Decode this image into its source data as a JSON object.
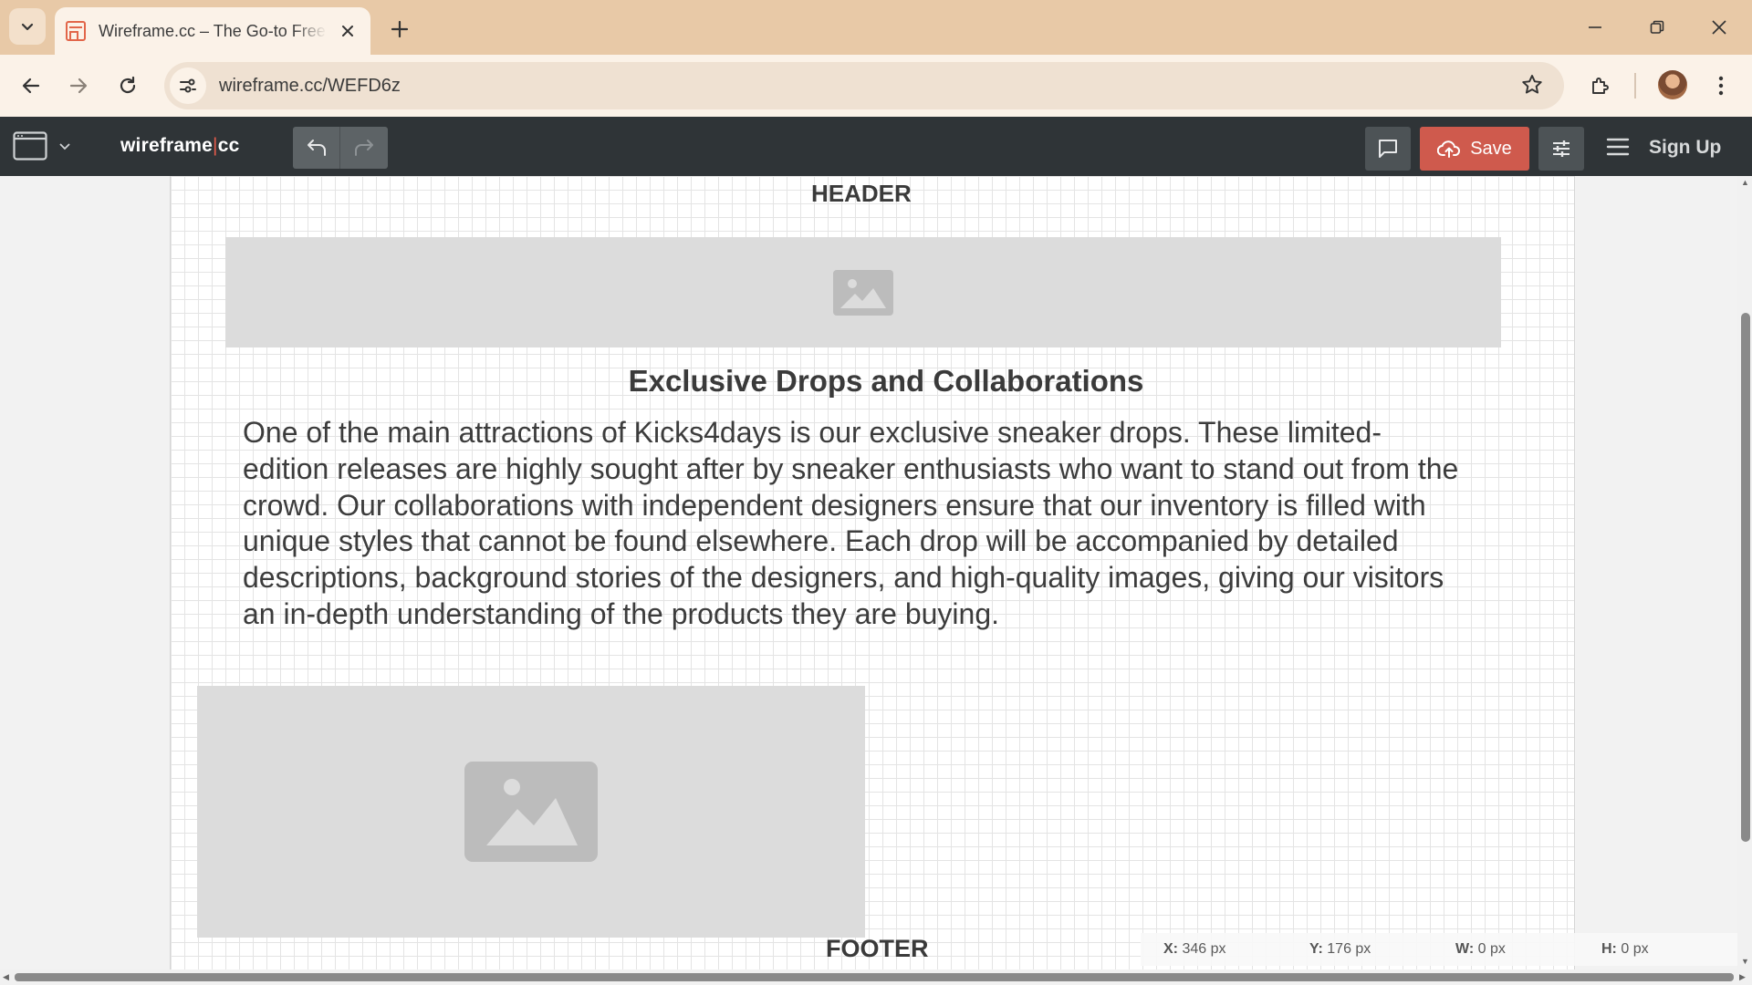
{
  "browser": {
    "tab_title": "Wireframe.cc – The Go-to Free, Minimal Wireframing Tool",
    "url": "wireframe.cc/WEFD6z"
  },
  "app": {
    "logo_main": "wireframe",
    "logo_bar": "|",
    "logo_suffix": "cc",
    "save_label": "Save",
    "signup_label": "Sign Up"
  },
  "canvas": {
    "header_label": "HEADER",
    "heading": "Exclusive Drops and Collaborations",
    "paragraph": "One of the main attractions of Kicks4days is our exclusive sneaker drops. These limited-edition releases are highly sought after by sneaker enthusiasts who want to stand out from the crowd. Our collaborations with independent designers ensure that our inventory is filled with unique styles that cannot be found elsewhere. Each drop will be accompanied by detailed descriptions, background stories of the designers, and high-quality images, giving our visitors an in-depth understanding of the products they are buying.",
    "footer_label": "FOOTER"
  },
  "status": {
    "x_label": "X:",
    "x_value": "346 px",
    "y_label": "Y:",
    "y_value": "176 px",
    "w_label": "W:",
    "w_value": "0 px",
    "h_label": "H:",
    "h_value": "0 px"
  },
  "colors": {
    "header_bg": "#2f3437",
    "save_bg": "#cf5a4d",
    "accent": "#e05a4b",
    "placeholder": "#dcdcdc"
  },
  "icons": [
    "tab-search-icon",
    "favicon-icon",
    "close-icon",
    "plus-icon",
    "minimize-icon",
    "restore-icon",
    "window-close-icon",
    "back-icon",
    "forward-icon",
    "reload-icon",
    "site-info-icon",
    "star-icon",
    "extensions-icon",
    "more-icon",
    "pages-icon",
    "undo-icon",
    "redo-icon",
    "comment-icon",
    "cloud-upload-icon",
    "sliders-icon",
    "menu-icon",
    "image-placeholder-icon"
  ]
}
